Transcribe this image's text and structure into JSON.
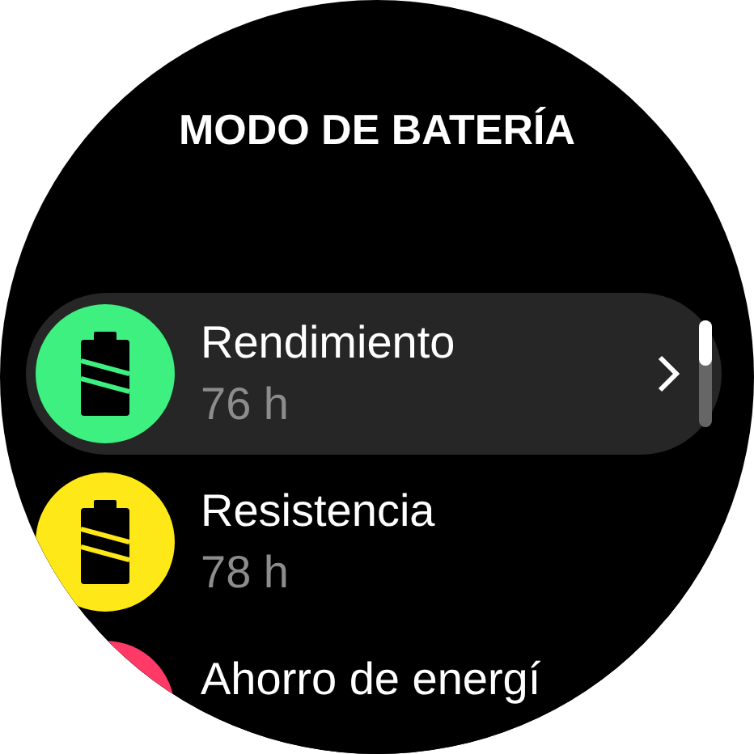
{
  "title": "MODO DE BATERÍA",
  "modes": [
    {
      "name": "Rendimiento",
      "duration": "76 h",
      "color": "#3ef07f",
      "selected": true
    },
    {
      "name": "Resistencia",
      "duration": "78 h",
      "color": "#ffe817",
      "selected": false
    },
    {
      "name": "Ahorro de energí",
      "color": "#ff3a66",
      "selected": false
    }
  ]
}
